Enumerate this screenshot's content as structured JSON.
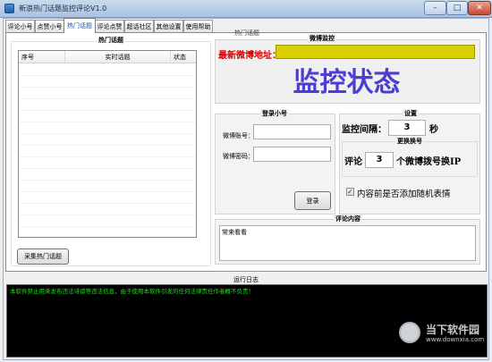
{
  "window": {
    "title": "新浪热门话题监控评论V1.0",
    "controls": {
      "minimize": "–",
      "maximize": "□",
      "close": "✕"
    }
  },
  "tabs": [
    "评论小号",
    "点赞小号",
    "热门话题",
    "评论点赞",
    "超话社区",
    "其他设置",
    "使用帮助"
  ],
  "hot_topics": {
    "group_title": "热门话题",
    "columns": [
      "序号",
      "实时话题",
      "状态"
    ],
    "rows": [],
    "collect_button": "采集热门话题"
  },
  "weibo_address": {
    "tab_label": "热门话题",
    "group_title": "微博监控",
    "label": "最新微博地址：",
    "value": "",
    "accent_color": "#d8d000"
  },
  "status": {
    "text": "监控状态",
    "color": "#4a3fd1"
  },
  "login": {
    "group_title": "登录小号",
    "account_label": "微博账号：",
    "account_value": "",
    "password_label": "微博密码：",
    "password_value": "",
    "login_button": "登录"
  },
  "settings": {
    "group_title": "设置",
    "interval_label": "监控间隔：",
    "interval_value": "3",
    "interval_unit": "秒",
    "switch_group_title": "更换换号",
    "switch_prefix": "评论",
    "switch_value": "3",
    "switch_suffix": "个微博拨号换IP",
    "random_emoji_label": "内容前是否添加随机表情",
    "random_emoji_checked": true
  },
  "comment": {
    "group_title": "评论内容",
    "value": "常来看看"
  },
  "log": {
    "title": "运行日志",
    "text": "本软件禁止用来发布违法诽谤等违法信息，由于使用本软件引发的任何法律责任作者概不负责！"
  },
  "watermark": {
    "text": "当下软件园",
    "url": "www.downxia.com"
  }
}
